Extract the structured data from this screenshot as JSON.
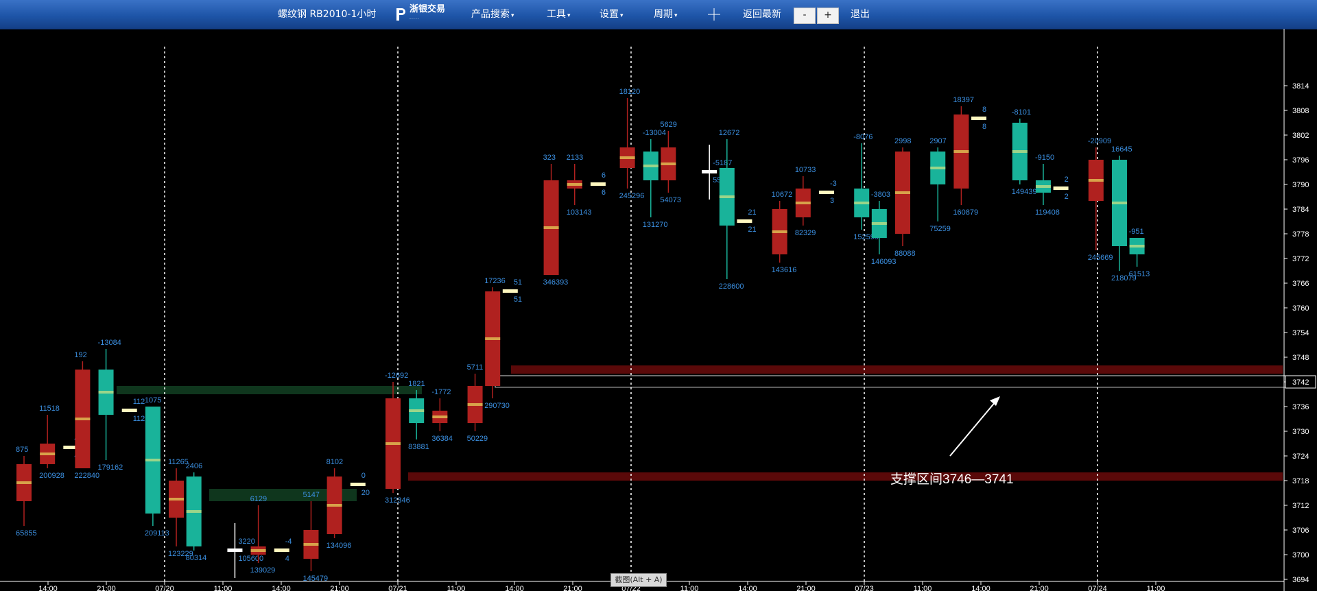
{
  "toolbar": {
    "title": "螺纹钢 RB2010-1小时",
    "logo_text": "浙银交易",
    "logo_sub": "·····",
    "menu_product": "产品搜索",
    "menu_tools": "工具",
    "menu_settings": "设置",
    "menu_period": "周期",
    "back_latest": "返回最新",
    "zoom_out": "-",
    "zoom_in": "+",
    "exit": "退出"
  },
  "screenshot_tooltip": "截图(Alt + A)",
  "colors": {
    "up": "#b0211f",
    "down": "#19b39a",
    "label": "#3b8fe0",
    "resistance_band": "#6a0a0a",
    "support_green": "#123f22",
    "background": "#000000"
  },
  "chart_data": {
    "type": "candlestick",
    "y_axis_ticks": [
      "3814",
      "3808",
      "3802",
      "3796",
      "3790",
      "3784",
      "3778",
      "3772",
      "3766",
      "3760",
      "3754",
      "3748",
      "3742",
      "3736",
      "3730",
      "3724",
      "3718",
      "3712",
      "3706",
      "3700",
      "3694"
    ],
    "ylim": [
      3693,
      3817
    ],
    "price_marker": "3742",
    "x_axis_ticks": [
      "14:00",
      "21:00",
      "07/20",
      "11:00",
      "14:00",
      "21:00",
      "07/21",
      "11:00",
      "14:00",
      "21:00",
      "07/22",
      "11:00",
      "14:00",
      "21:00",
      "07/23",
      "11:00",
      "14:00",
      "21:00",
      "07/24",
      "11:00"
    ],
    "day_separators": [
      "07/20",
      "07/21",
      "07/22",
      "07/23",
      "07/24"
    ],
    "annotation": "支撑区间3746—3741",
    "zones": [
      {
        "kind": "resistance",
        "from": 3746,
        "to": 3744
      },
      {
        "kind": "support-red",
        "from": 3720,
        "to": 3718
      },
      {
        "kind": "green",
        "from": 3741,
        "to": 3739
      },
      {
        "kind": "green",
        "from": 3716,
        "to": 3713
      }
    ],
    "candles": [
      {
        "slot": 0.0,
        "o": 3713,
        "c": 3722,
        "h": 3724,
        "l": 3707,
        "top": "875",
        "bot": "65855"
      },
      {
        "slot": 0.4,
        "o": 3722,
        "c": 3727,
        "h": 3734,
        "l": 3721,
        "top": "11518",
        "bot": "200928"
      },
      {
        "slot": 0.8,
        "flat": 3726,
        "top": "42",
        "bot": "42"
      },
      {
        "slot": 1.0,
        "o": 3721,
        "c": 3745,
        "h": 3747,
        "l": 3721,
        "top": "192",
        "bot": "222840"
      },
      {
        "slot": 1.4,
        "o": 3745,
        "c": 3734,
        "h": 3750,
        "l": 3723,
        "top": "-13084",
        "bot": "179162"
      },
      {
        "slot": 1.8,
        "flat": 3735,
        "top": "112",
        "bot": "112"
      },
      {
        "slot": 2.2,
        "o": 3736,
        "c": 3710,
        "h": 3736,
        "l": 3707,
        "top": "1075",
        "bot": "209113"
      },
      {
        "slot": 2.6,
        "o": 3709,
        "c": 3718,
        "h": 3721,
        "l": 3702,
        "top": "11265",
        "bot": "123229"
      },
      {
        "slot": 2.9,
        "o": 3719,
        "c": 3702,
        "h": 3720,
        "l": 3701,
        "top": "2406",
        "bot": "80314"
      },
      {
        "slot": 3.6,
        "flat": 3701,
        "top": "3220",
        "bot": "105600",
        "white": true
      },
      {
        "slot": 4.0,
        "o": 3700,
        "c": 3702,
        "h": 3712,
        "l": 3698,
        "top": "6129",
        "bot": "139029"
      },
      {
        "slot": 4.4,
        "flat": 3701,
        "top": "-4",
        "bot": "4"
      },
      {
        "slot": 4.9,
        "o": 3699,
        "c": 3706,
        "h": 3713,
        "l": 3696,
        "top": "5147",
        "bot": "145479"
      },
      {
        "slot": 5.3,
        "o": 3705,
        "c": 3719,
        "h": 3721,
        "l": 3704,
        "top": "8102",
        "bot": "134096"
      },
      {
        "slot": 5.7,
        "flat": 3717,
        "top": "0",
        "bot": "20"
      },
      {
        "slot": 6.3,
        "o": 3716,
        "c": 3738,
        "h": 3742,
        "l": 3715,
        "top": "-12692",
        "bot": "312346"
      },
      {
        "slot": 6.7,
        "o": 3738,
        "c": 3732,
        "h": 3740,
        "l": 3728,
        "top": "1821",
        "bot": "83881"
      },
      {
        "slot": 7.1,
        "o": 3732,
        "c": 3735,
        "h": 3738,
        "l": 3730,
        "top": "-1772",
        "bot": "36384"
      },
      {
        "slot": 7.7,
        "o": 3732,
        "c": 3741,
        "h": 3744,
        "l": 3730,
        "top": "5711",
        "bot": "50229"
      },
      {
        "slot": 8.0,
        "o": 3741,
        "c": 3764,
        "h": 3765,
        "l": 3738,
        "top": "17236",
        "bot": "290730"
      },
      {
        "slot": 8.3,
        "flat": 3764,
        "top": "51",
        "bot": "51"
      },
      {
        "slot": 9.0,
        "o": 3768,
        "c": 3791,
        "h": 3795,
        "l": 3768,
        "top": "323",
        "bot": "346393"
      },
      {
        "slot": 9.4,
        "o": 3789,
        "c": 3791,
        "h": 3795,
        "l": 3785,
        "top": "2133",
        "bot": "103143"
      },
      {
        "slot": 9.8,
        "flat": 3790,
        "top": "6",
        "bot": "6"
      },
      {
        "slot": 10.3,
        "o": 3794,
        "c": 3799,
        "h": 3811,
        "l": 3789,
        "top": "18120",
        "bot": "245296"
      },
      {
        "slot": 10.7,
        "o": 3798,
        "c": 3791,
        "h": 3801,
        "l": 3782,
        "top": "-13004",
        "bot": "131270"
      },
      {
        "slot": 11.0,
        "o": 3791,
        "c": 3799,
        "h": 3803,
        "l": 3788,
        "top": "5629",
        "bot": "54073"
      },
      {
        "slot": 11.7,
        "flat": 3793,
        "top": "-5187",
        "bot": "55389",
        "white": true
      },
      {
        "slot": 12.0,
        "o": 3794,
        "c": 3780,
        "h": 3801,
        "l": 3767,
        "top": "12672",
        "bot": "228600"
      },
      {
        "slot": 12.3,
        "flat": 3781,
        "top": "21",
        "bot": "21"
      },
      {
        "slot": 12.9,
        "o": 3773,
        "c": 3784,
        "h": 3786,
        "l": 3771,
        "top": "10672",
        "bot": "143616"
      },
      {
        "slot": 13.3,
        "o": 3782,
        "c": 3789,
        "h": 3792,
        "l": 3780,
        "top": "10733",
        "bot": "82329"
      },
      {
        "slot": 13.7,
        "flat": 3788,
        "top": "-3",
        "bot": "3"
      },
      {
        "slot": 14.3,
        "o": 3789,
        "c": 3782,
        "h": 3800,
        "l": 3779,
        "top": "-8076",
        "bot": "152598"
      },
      {
        "slot": 14.6,
        "o": 3784,
        "c": 3777,
        "h": 3786,
        "l": 3773,
        "top": "-3803",
        "bot": "146093"
      },
      {
        "slot": 15.0,
        "o": 3778,
        "c": 3798,
        "h": 3799,
        "l": 3775,
        "top": "2998",
        "bot": "88088"
      },
      {
        "slot": 15.6,
        "o": 3798,
        "c": 3790,
        "h": 3799,
        "l": 3781,
        "top": "2907",
        "bot": "75259"
      },
      {
        "slot": 16.0,
        "o": 3789,
        "c": 3807,
        "h": 3809,
        "l": 3785,
        "top": "18397",
        "bot": "160879"
      },
      {
        "slot": 16.3,
        "flat": 3806,
        "top": "8",
        "bot": "8"
      },
      {
        "slot": 17.0,
        "o": 3805,
        "c": 3791,
        "h": 3806,
        "l": 3790,
        "top": "-8101",
        "bot": "149439"
      },
      {
        "slot": 17.4,
        "o": 3791,
        "c": 3788,
        "h": 3795,
        "l": 3785,
        "top": "-9150",
        "bot": "119408"
      },
      {
        "slot": 17.7,
        "flat": 3789,
        "top": "2",
        "bot": "2"
      },
      {
        "slot": 18.3,
        "o": 3786,
        "c": 3796,
        "h": 3799,
        "l": 3774,
        "top": "-20909",
        "bot": "245669"
      },
      {
        "slot": 18.7,
        "o": 3796,
        "c": 3775,
        "h": 3797,
        "l": 3769,
        "top": "16645",
        "bot": "218079"
      },
      {
        "slot": 19.0,
        "o": 3777,
        "c": 3773,
        "h": 3777,
        "l": 3770,
        "top": "-951",
        "bot": "61513"
      }
    ]
  }
}
